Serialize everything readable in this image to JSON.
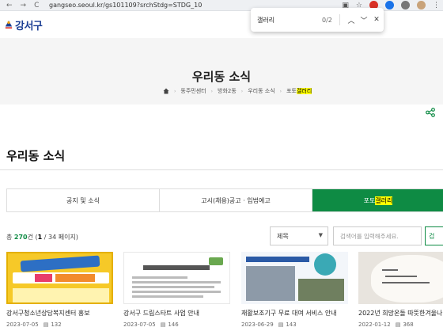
{
  "browser": {
    "url": "gangseo.seoul.kr/gs101109?srchStdg=STDG_10",
    "back_label": "←",
    "forward_label": "→",
    "reload_label": "C",
    "star_label": "☆",
    "menu_label": "⋮",
    "find": {
      "query": "갤러리",
      "count": "0/2",
      "prev_label": "︿",
      "next_label": "﹀",
      "close_label": "✕"
    }
  },
  "site": {
    "logo_text": "강서구",
    "brand_color": "#1c3f94"
  },
  "hero": {
    "title": "우리동 소식",
    "breadcrumb": [
      "동주민센터",
      "방화2동",
      "우리동 소식"
    ],
    "breadcrumb_last_prefix": "포토",
    "breadcrumb_last_highlight": "갤러리"
  },
  "section": {
    "title": "우리동 소식"
  },
  "tabs": [
    {
      "label": "공지 및 소식",
      "active": false
    },
    {
      "label": "고시(채용)공고 · 입법예고",
      "active": false
    },
    {
      "label_prefix": "포토",
      "label_highlight": "갤러리",
      "active": true
    }
  ],
  "accent_color": "#0e8b44",
  "list": {
    "total_prefix": "총 ",
    "total_count": "270",
    "total_suffix": "건 (",
    "current_page": "1",
    "pages_suffix": " / 34 페이지)",
    "filter_value": "제목",
    "search_placeholder": "검색어를 입력해주세요.",
    "search_button": "검"
  },
  "gallery": [
    {
      "title": "강서구청소년상담복지센터 홍보",
      "date": "2023-07-05",
      "views": "132"
    },
    {
      "title": "강서구 드림스타트 사업 안내",
      "date": "2023-07-05",
      "views": "146"
    },
    {
      "title": "재활보조기구 무료 대여 서비스 안내",
      "date": "2023-06-29",
      "views": "143"
    },
    {
      "title": "2022년 희망온돌 따뜻한겨울나기",
      "date": "2022-01-12",
      "views": "368"
    }
  ]
}
